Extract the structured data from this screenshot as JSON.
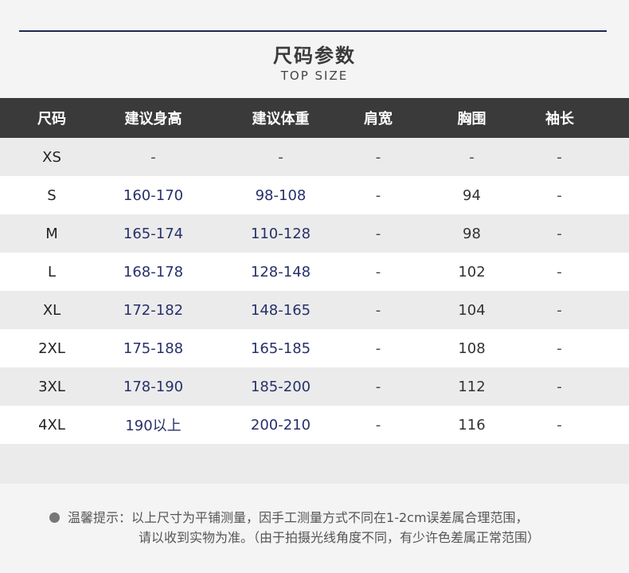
{
  "heading": {
    "title": "尺码参数",
    "subtitle": "TOP SIZE"
  },
  "table": {
    "headers": [
      "尺码",
      "建议身高",
      "建议体重",
      "肩宽",
      "胸围",
      "袖长"
    ],
    "rows": [
      [
        "XS",
        "-",
        "-",
        "-",
        "-",
        "-"
      ],
      [
        "S",
        "160-170",
        "98-108",
        "-",
        "94",
        "-"
      ],
      [
        "M",
        "165-174",
        "110-128",
        "-",
        "98",
        "-"
      ],
      [
        "L",
        "168-178",
        "128-148",
        "-",
        "102",
        "-"
      ],
      [
        "XL",
        "172-182",
        "148-165",
        "-",
        "104",
        "-"
      ],
      [
        "2XL",
        "175-188",
        "165-185",
        "-",
        "108",
        "-"
      ],
      [
        "3XL",
        "178-190",
        "185-200",
        "-",
        "112",
        "-"
      ],
      [
        "4XL",
        "190以上",
        "200-210",
        "-",
        "116",
        "-"
      ]
    ]
  },
  "note": {
    "label": "温馨提示：",
    "line1": "以上尺寸为平铺测量，因手工测量方式不同在1-2cm误差属合理范围，",
    "line2": "请以收到实物为准。（由于拍摄光线角度不同，有少许色差属正常范围）"
  },
  "colors": {
    "accent_navy": "#27306a",
    "header_bg": "#3a3a3a",
    "rule": "#1f2752"
  }
}
